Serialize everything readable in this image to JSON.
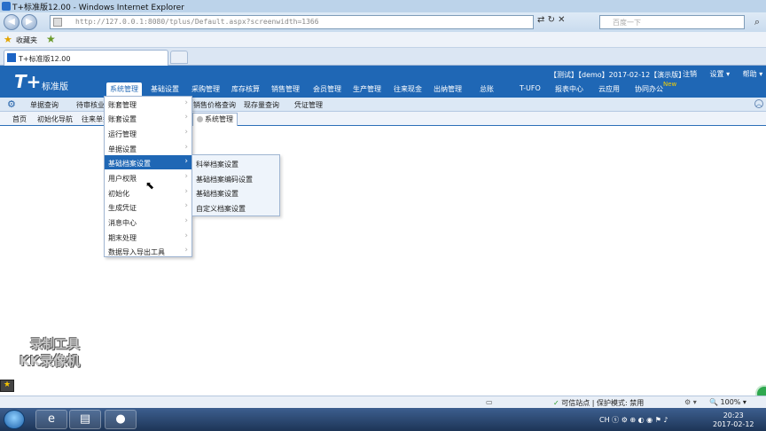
{
  "window": {
    "title": "T+标准版12.00 - Windows Internet Explorer"
  },
  "address_bar": {
    "url": "http://127.0.0.1:8080/tplus/Default.aspx?screenwidth=1366",
    "search_placeholder": "百度一下"
  },
  "favorites_bar": {
    "label": "收藏夹"
  },
  "browser_tab": {
    "title": "T+标准版12.00"
  },
  "app": {
    "logo": "T+",
    "logo_sub": "标准版",
    "user_info": "【测试】【demo】2017-02-12【演示版】",
    "header_links": [
      "注销",
      "设置 ▾",
      "帮助 ▾"
    ],
    "top_menu": [
      {
        "label": "系统管理",
        "active": true
      },
      {
        "label": "基础设置"
      },
      {
        "label": "采购管理"
      },
      {
        "label": "库存核算"
      },
      {
        "label": "销售管理"
      },
      {
        "label": "会员管理"
      },
      {
        "label": "生产管理"
      },
      {
        "label": "往来现金"
      },
      {
        "label": "出纳管理"
      },
      {
        "label": "总账"
      },
      {
        "label": "T-UFO"
      },
      {
        "label": "报表中心"
      },
      {
        "label": "云应用"
      },
      {
        "label": "协同办公"
      }
    ],
    "new_badge": "New"
  },
  "toolbar2": {
    "items": [
      "单据查询",
      "待审核业务",
      "销售价格查询",
      "现存量查询",
      "凭证管理"
    ]
  },
  "page_tabs": {
    "items": [
      "首页",
      "初始化导航",
      "往来单据"
    ],
    "selected": "系统管理"
  },
  "dropdown": {
    "items": [
      {
        "label": "账套管理",
        "has_sub": true
      },
      {
        "label": "账套设置",
        "has_sub": true
      },
      {
        "label": "运行管理",
        "has_sub": true
      },
      {
        "label": "单据设置",
        "has_sub": true
      },
      {
        "label": "基础档案设置",
        "has_sub": true,
        "highlighted": true
      },
      {
        "label": "用户权限",
        "has_sub": true
      },
      {
        "label": "初始化",
        "has_sub": true
      },
      {
        "label": "生成凭证",
        "has_sub": true
      },
      {
        "label": "消息中心",
        "has_sub": true
      },
      {
        "label": "期末处理",
        "has_sub": true
      },
      {
        "label": "数据导入导出工具",
        "has_sub": true
      }
    ],
    "submenu": [
      "科举档案设置",
      "基础档案编码设置",
      "基础档案设置",
      "自定义档案设置"
    ]
  },
  "watermark": {
    "line1": "录制工具",
    "line2": "KK录像机"
  },
  "status_bar": {
    "zone": "可信站点",
    "protected_mode": "保护模式: 禁用",
    "zoom": "100%"
  },
  "taskbar": {
    "time": "20:23",
    "date": "2017-02-12",
    "tray_text": "CH"
  }
}
